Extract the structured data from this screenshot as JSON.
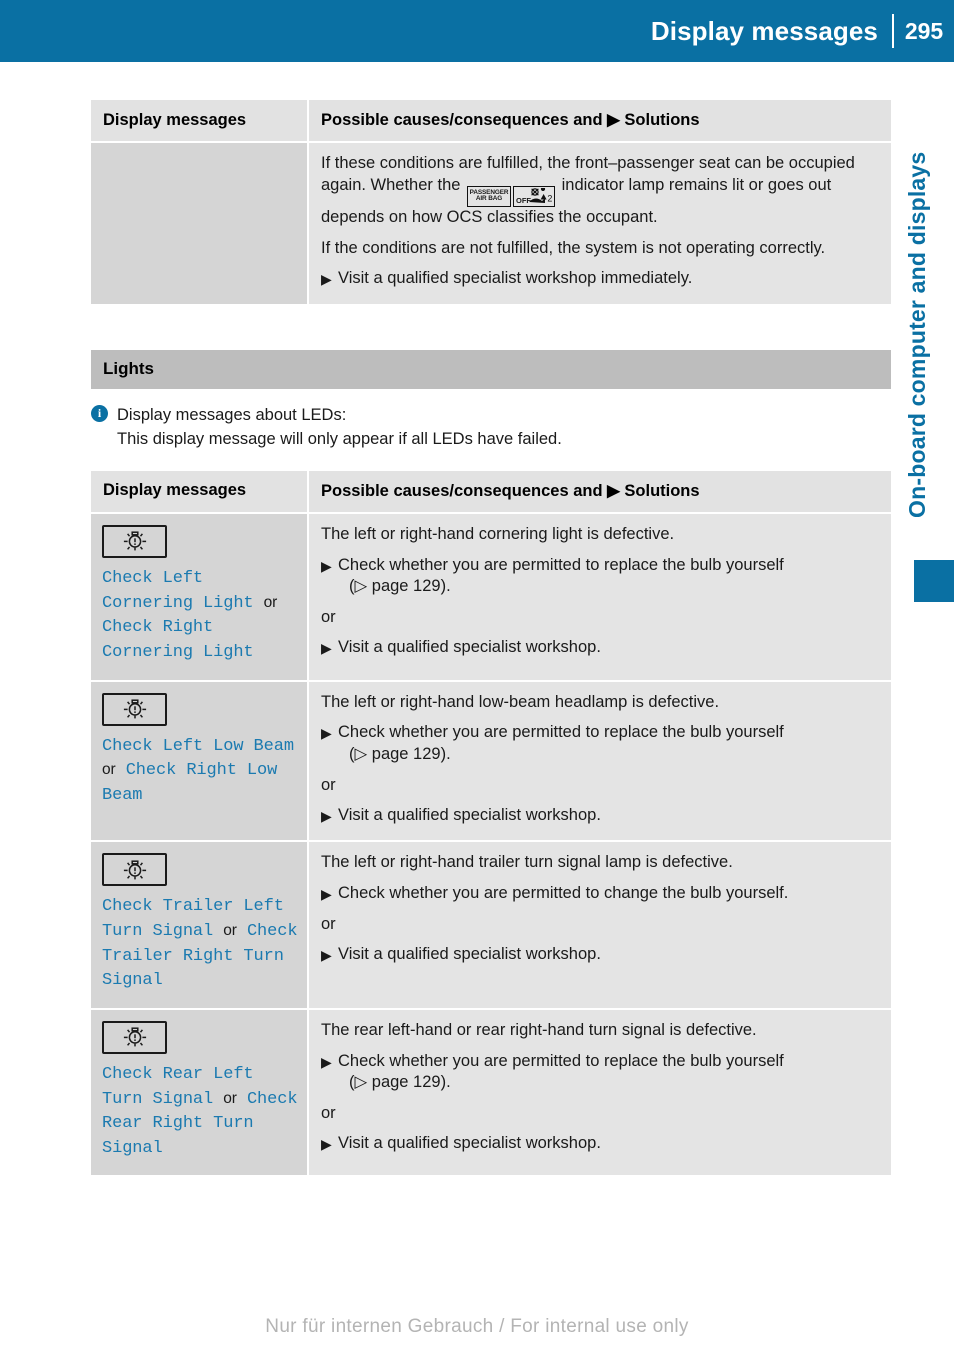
{
  "header": {
    "title": "Display messages",
    "page_number": "295"
  },
  "side_tab": {
    "label": "On-board computer and displays",
    "accent_color": "#0a70a3"
  },
  "table_top": {
    "columns": [
      "Display messages",
      "Possible causes/consequences and ▶ Solutions"
    ],
    "rows": [
      {
        "message": "",
        "paragraph_1_before_icons": "If these conditions are fulfilled, the front–passenger seat can be occupied again. Whether the",
        "icon_1_line_1": "PASSENGER",
        "icon_1_line_2": "AIR BAG",
        "icon_2_label": "OFF",
        "paragraph_1_after_icons": "indicator lamp remains lit or goes out depends on how OCS classifies the occupant.",
        "paragraph_2": "If the conditions are not fulfilled, the system is not operating correctly.",
        "solution_1": "Visit a qualified specialist workshop immediately."
      }
    ]
  },
  "section": {
    "title": "Lights"
  },
  "note": {
    "line_1": "Display messages about LEDs:",
    "line_2": "This display message will only appear if all LEDs have failed."
  },
  "table_lights": {
    "columns": [
      "Display messages",
      "Possible causes/consequences and ▶ Solutions"
    ],
    "rows": [
      {
        "icon": "lamp-defect-icon",
        "message_part_1": "Check Left Cornering Light",
        "message_conjunction": "or",
        "message_part_2": "Check Right Cornering Light",
        "cause": "The left or right-hand cornering light is defective.",
        "solution_1": "Check whether you are permitted to replace the bulb yourself",
        "solution_1_ref": "(▷ page 129).",
        "or_label": "or",
        "solution_2": "Visit a qualified specialist workshop."
      },
      {
        "icon": "lamp-defect-icon",
        "message_part_1": "Check Left Low Beam",
        "message_conjunction": "or",
        "message_part_2": "Check Right Low Beam",
        "cause": "The left or right-hand low-beam headlamp is defective.",
        "solution_1": "Check whether you are permitted to replace the bulb yourself",
        "solution_1_ref": "(▷ page 129).",
        "or_label": "or",
        "solution_2": "Visit a qualified specialist workshop."
      },
      {
        "icon": "lamp-defect-icon",
        "message_part_1": "Check Trailer Left Turn Signal",
        "message_conjunction": "or",
        "message_part_2": "Check Trailer Right Turn Signal",
        "cause": "The left or right-hand trailer turn signal lamp is defective.",
        "solution_1": "Check whether you are permitted to change the bulb yourself.",
        "solution_1_ref": "",
        "or_label": "or",
        "solution_2": "Visit a qualified specialist workshop."
      },
      {
        "icon": "lamp-defect-icon",
        "message_part_1": "Check Rear Left Turn Signal",
        "message_conjunction": "or",
        "message_part_2": "Check Rear Right Turn Signal",
        "cause": "The rear left-hand or rear right-hand turn signal is defective.",
        "solution_1": "Check whether you are permitted to replace the bulb yourself",
        "solution_1_ref": "(▷ page 129).",
        "or_label": "or",
        "solution_2": "Visit a qualified specialist workshop."
      }
    ]
  },
  "footer": {
    "watermark": "Nur für internen Gebrauch / For internal use only"
  }
}
